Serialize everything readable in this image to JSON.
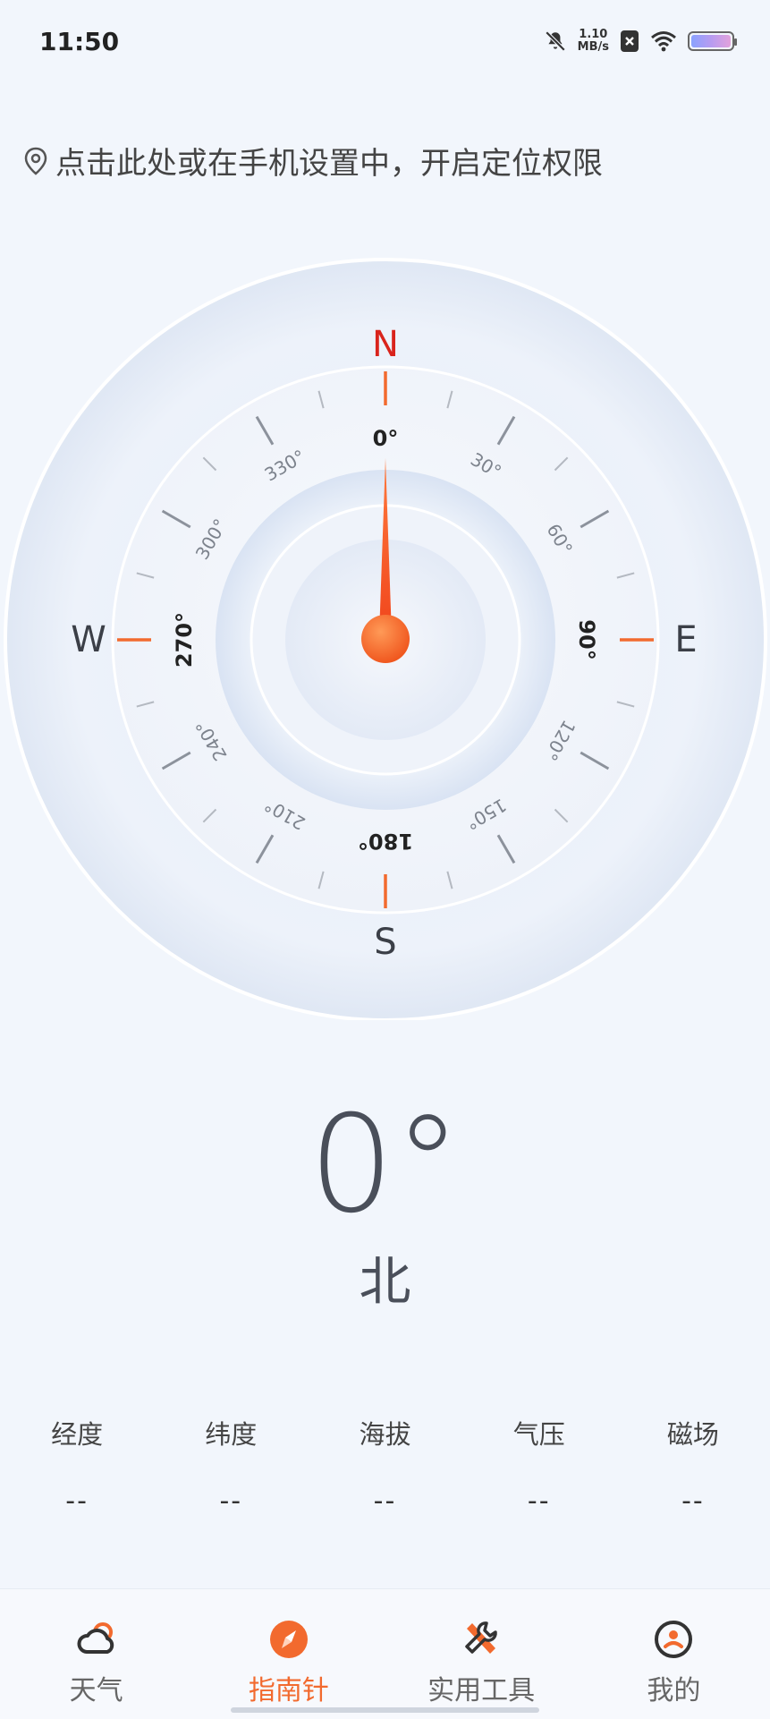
{
  "status_bar": {
    "time": "11:50",
    "net_speed_value": "1.10",
    "net_speed_unit": "MB/s",
    "icons": [
      "mute-bell-icon",
      "sim-off-icon",
      "wifi-icon",
      "battery-icon"
    ]
  },
  "location_tip": {
    "icon": "location-pin-icon",
    "text": "点击此处或在手机设置中，开启定位权限"
  },
  "compass": {
    "cardinals": {
      "north": "N",
      "east": "E",
      "south": "S",
      "west": "W"
    },
    "degree_labels": [
      "0°",
      "30°",
      "60°",
      "90°",
      "120°",
      "150°",
      "180°",
      "210°",
      "240°",
      "270°",
      "300°",
      "330°"
    ],
    "accent_color": "#f26a2e",
    "north_color": "#d9241c"
  },
  "heading": {
    "value": "0°",
    "direction": "北"
  },
  "info": [
    {
      "label": "经度",
      "value": "--"
    },
    {
      "label": "纬度",
      "value": "--"
    },
    {
      "label": "海拔",
      "value": "--"
    },
    {
      "label": "气压",
      "value": "--"
    },
    {
      "label": "磁场",
      "value": "--"
    }
  ],
  "tabs": [
    {
      "label": "天气",
      "icon": "weather-cloud-icon",
      "active": false
    },
    {
      "label": "指南针",
      "icon": "compass-icon",
      "active": true
    },
    {
      "label": "实用工具",
      "icon": "tools-icon",
      "active": false
    },
    {
      "label": "我的",
      "icon": "profile-icon",
      "active": false
    }
  ]
}
